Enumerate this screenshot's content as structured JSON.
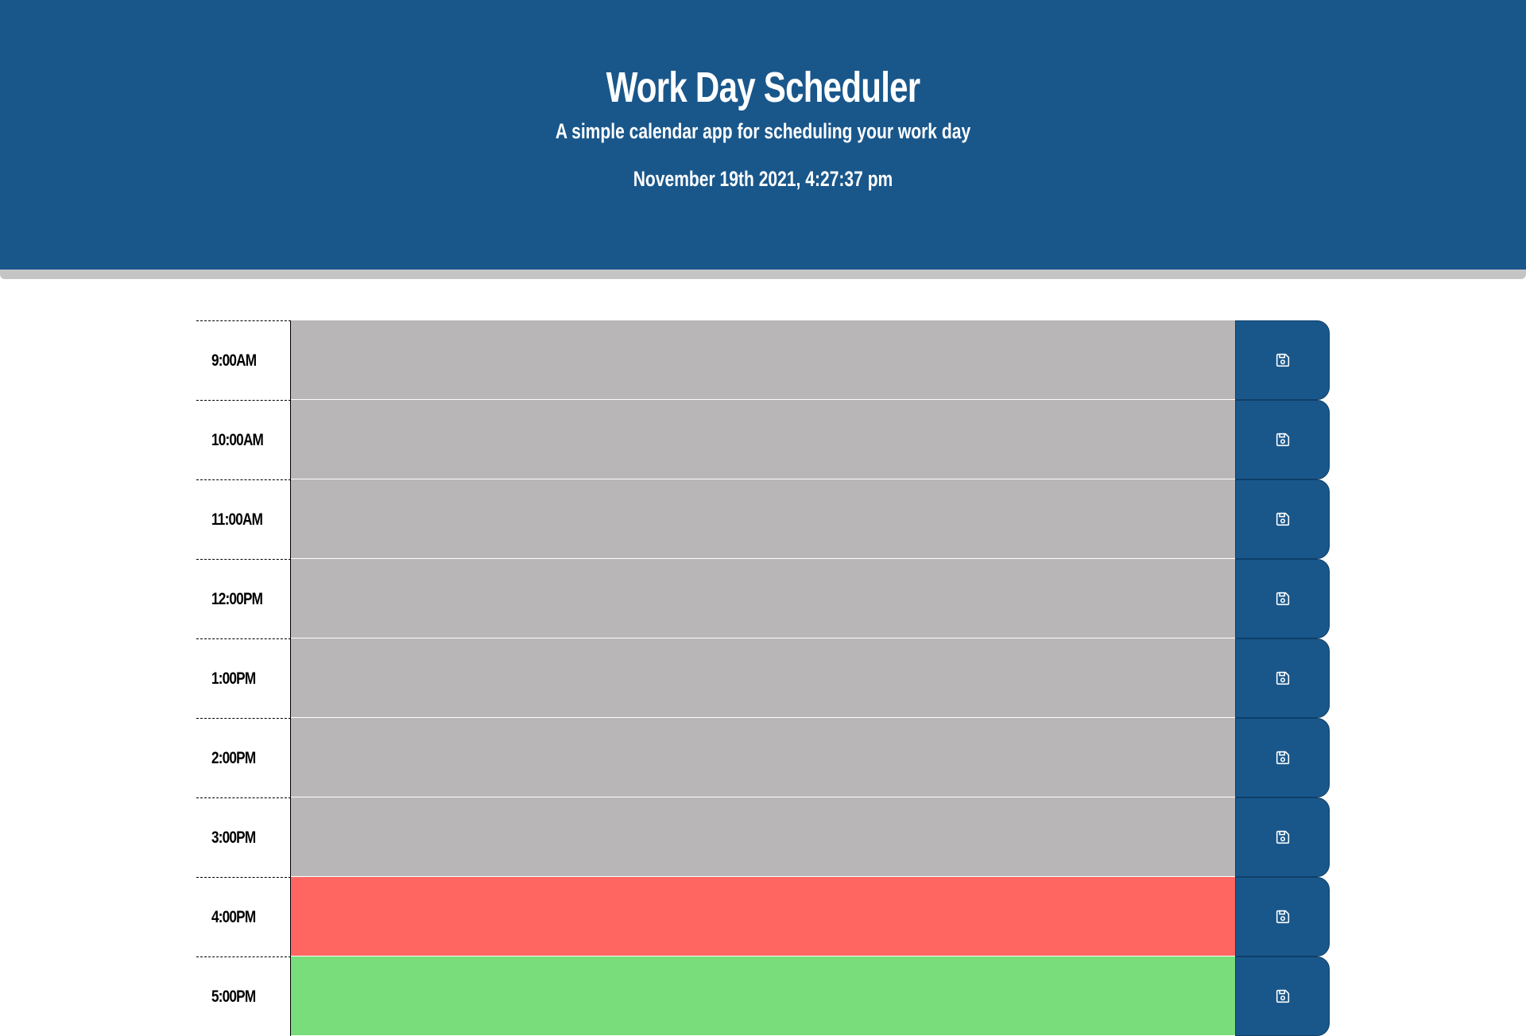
{
  "header": {
    "title": "Work Day Scheduler",
    "subtitle": "A simple calendar app for scheduling your work day",
    "current_day": "November 19th 2021, 4:27:37 pm"
  },
  "colors": {
    "past": "#b8b6b7",
    "present": "#ff6661",
    "future": "#78dd7a",
    "accent": "#19578b"
  },
  "rows": [
    {
      "hour": "9:00AM",
      "status": "past",
      "text": ""
    },
    {
      "hour": "10:00AM",
      "status": "past",
      "text": ""
    },
    {
      "hour": "11:00AM",
      "status": "past",
      "text": ""
    },
    {
      "hour": "12:00PM",
      "status": "past",
      "text": ""
    },
    {
      "hour": "1:00PM",
      "status": "past",
      "text": ""
    },
    {
      "hour": "2:00PM",
      "status": "past",
      "text": ""
    },
    {
      "hour": "3:00PM",
      "status": "past",
      "text": ""
    },
    {
      "hour": "4:00PM",
      "status": "present",
      "text": ""
    },
    {
      "hour": "5:00PM",
      "status": "future",
      "text": ""
    }
  ],
  "save_icon": "save-icon"
}
